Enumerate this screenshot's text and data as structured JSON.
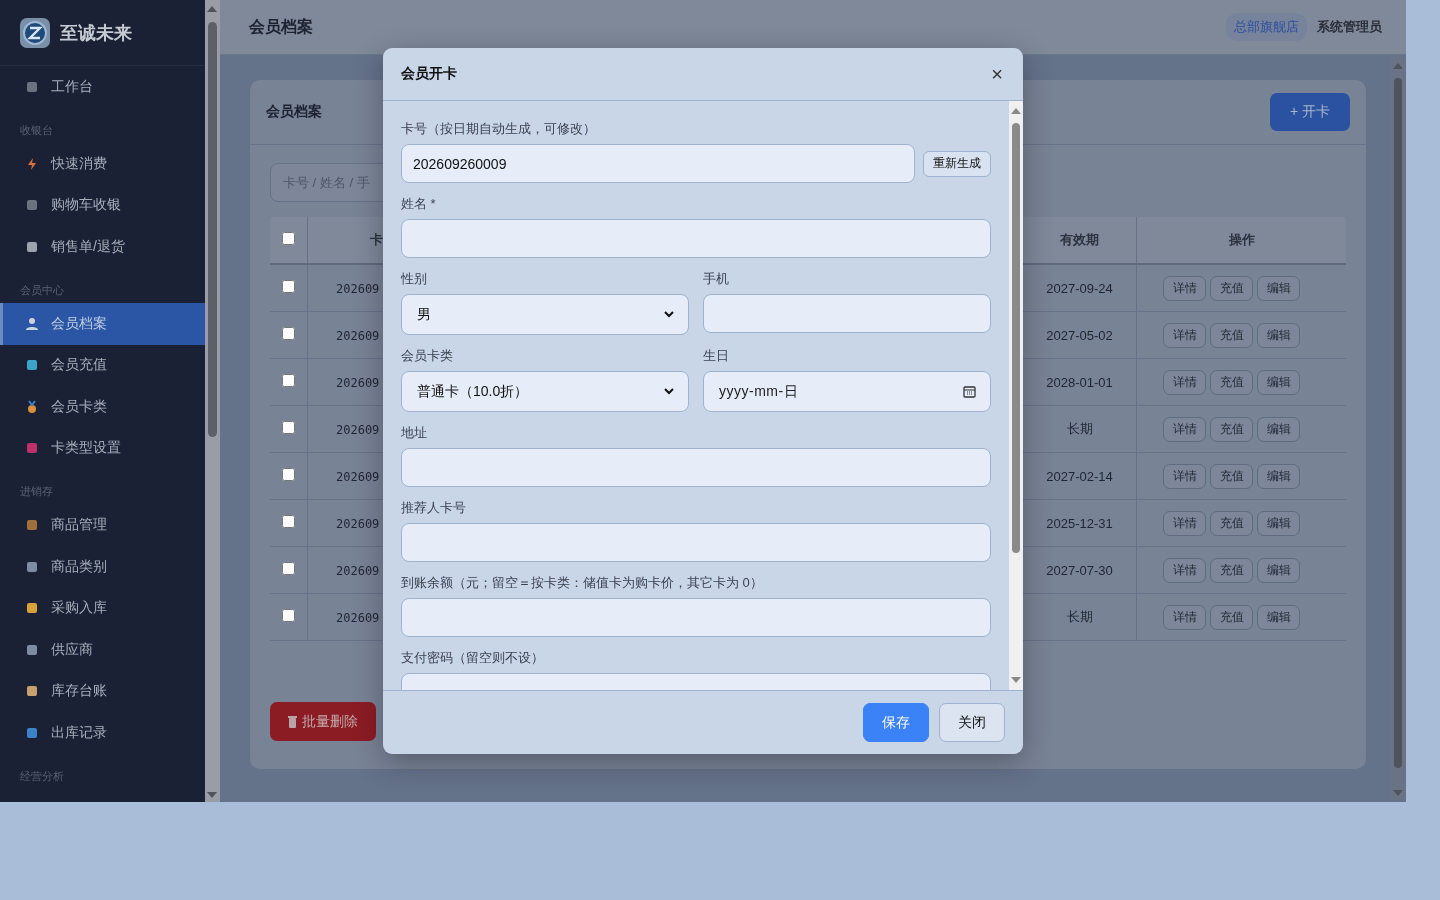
{
  "sidebar": {
    "brand": "至诚未来",
    "sections": [
      {
        "items": [
          {
            "label": "工作台",
            "selected": false
          }
        ]
      },
      {
        "title": "收银台",
        "items": [
          {
            "label": "快速消费",
            "selected": false
          },
          {
            "label": "购物车收银",
            "selected": false
          },
          {
            "label": "销售单/退货",
            "selected": false
          }
        ]
      },
      {
        "title": "会员中心",
        "items": [
          {
            "label": "会员档案",
            "selected": true
          },
          {
            "label": "会员充值",
            "selected": false
          },
          {
            "label": "会员卡类",
            "selected": false
          },
          {
            "label": "卡类型设置",
            "selected": false
          }
        ]
      },
      {
        "title": "进销存",
        "items": [
          {
            "label": "商品管理",
            "selected": false
          },
          {
            "label": "商品类别",
            "selected": false
          },
          {
            "label": "采购入库",
            "selected": false
          },
          {
            "label": "供应商",
            "selected": false
          },
          {
            "label": "库存台账",
            "selected": false
          },
          {
            "label": "出库记录",
            "selected": false
          }
        ]
      },
      {
        "title": "经营分析"
      }
    ]
  },
  "header": {
    "title": "会员档案",
    "store": "总部旗舰店",
    "user": "系统管理员"
  },
  "card": {
    "title": "会员档案",
    "add_button": "+ 开卡",
    "search": {
      "placeholder": "卡号 / 姓名 / 手"
    },
    "table": {
      "header_checked": false,
      "columns": [
        "卡",
        "有效期",
        "操作"
      ],
      "rows": [
        {
          "checked": false,
          "card_no": "202609",
          "expiry": "2027-09-24",
          "actions": [
            "详情",
            "充值",
            "编辑"
          ]
        },
        {
          "checked": false,
          "card_no": "202609",
          "expiry": "2027-05-02",
          "actions": [
            "详情",
            "充值",
            "编辑"
          ]
        },
        {
          "checked": false,
          "card_no": "202609",
          "expiry": "2028-01-01",
          "actions": [
            "详情",
            "充值",
            "编辑"
          ]
        },
        {
          "checked": false,
          "card_no": "202609",
          "expiry": "长期",
          "actions": [
            "详情",
            "充值",
            "编辑"
          ]
        },
        {
          "checked": false,
          "card_no": "202609",
          "expiry": "2027-02-14",
          "actions": [
            "详情",
            "充值",
            "编辑"
          ]
        },
        {
          "checked": false,
          "card_no": "202609",
          "expiry": "2025-12-31",
          "actions": [
            "详情",
            "充值",
            "编辑"
          ]
        },
        {
          "checked": false,
          "card_no": "202609",
          "expiry": "2027-07-30",
          "actions": [
            "详情",
            "充值",
            "编辑"
          ]
        },
        {
          "checked": false,
          "card_no": "202609",
          "expiry": "长期",
          "actions": [
            "详情",
            "充值",
            "编辑"
          ]
        }
      ]
    },
    "batch_delete": "批量删除"
  },
  "modal": {
    "title": "会员开卡",
    "close": "×",
    "fields": [
      {
        "kind": "text_button",
        "label": "卡号（按日期自动生成，可修改）",
        "value": "202609260009",
        "button": "重新生成"
      },
      {
        "kind": "text",
        "label": "姓名 *"
      },
      {
        "kind": "pair",
        "fields": [
          {
            "kind": "select",
            "label": "性别",
            "value": "男"
          },
          {
            "kind": "text",
            "label": "手机"
          }
        ]
      },
      {
        "kind": "pair",
        "fields": [
          {
            "kind": "select",
            "label": "会员卡类",
            "value": "普通卡（10.0折）"
          },
          {
            "kind": "date",
            "label": "生日",
            "placeholder": "yyyy-mm-日"
          }
        ]
      },
      {
        "kind": "text",
        "label": "地址"
      },
      {
        "kind": "text",
        "label": "推荐人卡号"
      },
      {
        "kind": "text",
        "label": "到账余额（元；留空＝按卡类：储值卡为购卡价，其它卡为 0）"
      },
      {
        "kind": "text",
        "label": "支付密码（留空则不设）"
      }
    ],
    "buttons": [
      {
        "kind": "primary",
        "label": "保存"
      },
      {
        "kind": "secondary",
        "label": "关闭"
      }
    ]
  }
}
